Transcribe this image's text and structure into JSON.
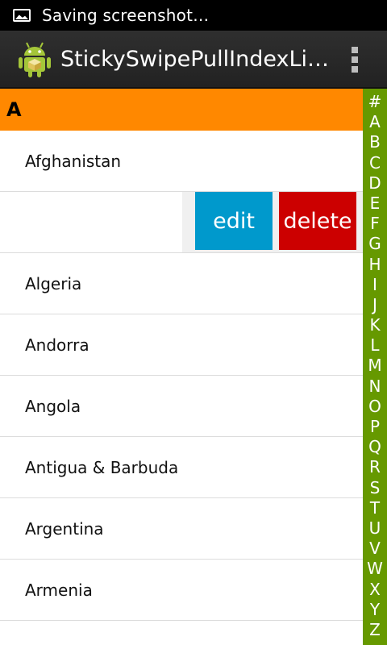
{
  "status_bar": {
    "text": "Saving screenshot…",
    "icon": "picture-icon"
  },
  "action_bar": {
    "title": "StickySwipePullIndexLi…",
    "icon": "android-icon",
    "overflow_icon": "overflow-menu-icon"
  },
  "list": {
    "section_header": "A",
    "rows": [
      {
        "label": "Afghanistan"
      },
      {
        "label": "",
        "swiped": true,
        "edit_label": "edit",
        "delete_label": "delete"
      },
      {
        "label": "Algeria"
      },
      {
        "label": "Andorra"
      },
      {
        "label": "Angola"
      },
      {
        "label": "Antigua & Barbuda"
      },
      {
        "label": "Argentina"
      },
      {
        "label": "Armenia"
      }
    ]
  },
  "index_bar": {
    "letters": [
      "#",
      "A",
      "B",
      "C",
      "D",
      "E",
      "F",
      "G",
      "H",
      "I",
      "J",
      "K",
      "L",
      "M",
      "N",
      "O",
      "P",
      "Q",
      "R",
      "S",
      "T",
      "U",
      "V",
      "W",
      "X",
      "Y",
      "Z"
    ]
  },
  "colors": {
    "section_header_bg": "#ff8800",
    "index_bar_bg": "#669900",
    "edit_button_bg": "#0099cc",
    "delete_button_bg": "#cc0000"
  }
}
